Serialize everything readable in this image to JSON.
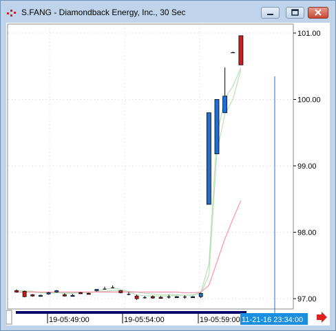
{
  "window": {
    "title": "S.FANG - Diamondback Energy, Inc., 30 Sec"
  },
  "icons": {
    "app": "chart-app-icon",
    "minimize": "minimize-icon",
    "maximize": "maximize-icon",
    "close": "close-icon",
    "scroll": "arrow-right-icon"
  },
  "colors": {
    "up": "#1f6fd6",
    "down": "#cc1f1f",
    "fast_ma": "#ff8fa8",
    "slow_ma": "#b8e0b8",
    "cursor": "#1a6fd0",
    "time_strip": "#0a0a6e",
    "time_label_bg": "#1a8fe0",
    "arrow": "#e02020"
  },
  "price_axis": {
    "labels": [
      "101.00",
      "100.00",
      "99.00",
      "98.00",
      "97.00"
    ]
  },
  "time_axis": {
    "labels": [
      "19-05:49:00",
      "19-05:54:00",
      "19-05:59:00"
    ],
    "cursor_label": "11-21-16 23:34:00"
  },
  "chart_data": {
    "type": "candlestick",
    "title": "S.FANG - Diamondback Energy, Inc., 30 Sec",
    "ylim": [
      96.9,
      101.25
    ],
    "yticks": [
      101.0,
      100.0,
      99.0,
      98.0,
      97.0
    ],
    "xticks": [
      "19-05:49:00",
      "19-05:54:00",
      "19-05:59:00"
    ],
    "candles": [
      {
        "o": 97.12,
        "h": 97.14,
        "l": 97.09,
        "c": 97.1,
        "dir": "down"
      },
      {
        "o": 97.11,
        "h": 97.12,
        "l": 97.02,
        "c": 97.03,
        "dir": "down"
      },
      {
        "o": 97.06,
        "h": 97.07,
        "l": 97.03,
        "c": 97.04,
        "dir": "down"
      },
      {
        "o": 97.05,
        "h": 97.06,
        "l": 97.03,
        "c": 97.05,
        "dir": "up"
      },
      {
        "o": 97.07,
        "h": 97.1,
        "l": 97.06,
        "c": 97.09,
        "dir": "up"
      },
      {
        "o": 97.1,
        "h": 97.13,
        "l": 97.09,
        "c": 97.12,
        "dir": "up"
      },
      {
        "o": 97.06,
        "h": 97.08,
        "l": 97.03,
        "c": 97.04,
        "dir": "down"
      },
      {
        "o": 97.05,
        "h": 97.07,
        "l": 97.04,
        "c": 97.05,
        "dir": "up"
      },
      {
        "o": 97.09,
        "h": 97.1,
        "l": 97.07,
        "c": 97.08,
        "dir": "down"
      },
      {
        "o": 97.08,
        "h": 97.09,
        "l": 97.07,
        "c": 97.08,
        "dir": "down"
      },
      {
        "o": 97.12,
        "h": 97.14,
        "l": 97.11,
        "c": 97.14,
        "dir": "up"
      },
      {
        "o": 97.15,
        "h": 97.18,
        "l": 97.14,
        "c": 97.15,
        "dir": "flat"
      },
      {
        "o": 97.17,
        "h": 97.2,
        "l": 97.16,
        "c": 97.17,
        "dir": "flat"
      },
      {
        "o": 97.12,
        "h": 97.13,
        "l": 97.08,
        "c": 97.09,
        "dir": "down"
      },
      {
        "o": 97.07,
        "h": 97.1,
        "l": 97.05,
        "c": 97.06,
        "dir": "flat"
      },
      {
        "o": 97.04,
        "h": 97.06,
        "l": 96.98,
        "c": 97.0,
        "dir": "down"
      },
      {
        "o": 97.02,
        "h": 97.04,
        "l": 97.0,
        "c": 97.02,
        "dir": "flat"
      },
      {
        "o": 97.03,
        "h": 97.05,
        "l": 97.0,
        "c": 97.01,
        "dir": "down"
      },
      {
        "o": 97.02,
        "h": 97.04,
        "l": 97.0,
        "c": 97.02,
        "dir": "down"
      },
      {
        "o": 97.01,
        "h": 97.06,
        "l": 97.0,
        "c": 97.03,
        "dir": "flat"
      },
      {
        "o": 97.02,
        "h": 97.04,
        "l": 97.01,
        "c": 97.03,
        "dir": "up"
      },
      {
        "o": 97.03,
        "h": 97.05,
        "l": 97.0,
        "c": 97.01,
        "dir": "flat"
      },
      {
        "o": 97.03,
        "h": 97.04,
        "l": 97.01,
        "c": 97.02,
        "dir": "up"
      },
      {
        "o": 97.03,
        "h": 97.09,
        "l": 97.01,
        "c": 97.08,
        "dir": "up"
      },
      {
        "o": 98.42,
        "h": 99.8,
        "l": 98.42,
        "c": 99.8,
        "dir": "up"
      },
      {
        "o": 99.18,
        "h": 100.0,
        "l": 99.18,
        "c": 100.0,
        "dir": "up"
      },
      {
        "o": 99.8,
        "h": 100.48,
        "l": 99.8,
        "c": 100.05,
        "dir": "up"
      },
      {
        "o": 100.71,
        "h": 100.72,
        "l": 100.71,
        "c": 100.71,
        "dir": "flat"
      },
      {
        "o": 100.96,
        "h": 100.96,
        "l": 100.52,
        "c": 100.52,
        "dir": "down"
      }
    ],
    "series": [
      {
        "values": [
          97.12,
          97.12,
          97.11,
          97.09,
          97.08,
          97.09,
          97.08,
          97.08,
          97.09,
          97.09,
          97.11,
          97.14,
          97.16,
          97.14,
          97.1,
          97.06,
          97.04,
          97.04,
          97.04,
          97.04,
          97.05,
          97.05,
          97.06,
          97.09,
          97.52,
          99.45,
          100.02,
          100.2,
          100.48
        ]
      },
      {
        "values": [
          97.1,
          97.1,
          97.1,
          97.09,
          97.09,
          97.09,
          97.09,
          97.09,
          97.09,
          97.09,
          97.1,
          97.11,
          97.12,
          97.12,
          97.11,
          97.1,
          97.08,
          97.07,
          97.06,
          97.06,
          97.06,
          97.05,
          97.05,
          97.08,
          97.35,
          99.2,
          99.78,
          100.0,
          100.45
        ]
      },
      {
        "values": [
          97.1,
          97.1,
          97.1,
          97.1,
          97.1,
          97.1,
          97.1,
          97.1,
          97.1,
          97.1,
          97.1,
          97.1,
          97.1,
          97.1,
          97.1,
          97.1,
          97.1,
          97.1,
          97.1,
          97.1,
          97.1,
          97.09,
          97.09,
          97.1,
          97.2,
          97.55,
          97.9,
          98.2,
          98.48
        ]
      }
    ]
  }
}
